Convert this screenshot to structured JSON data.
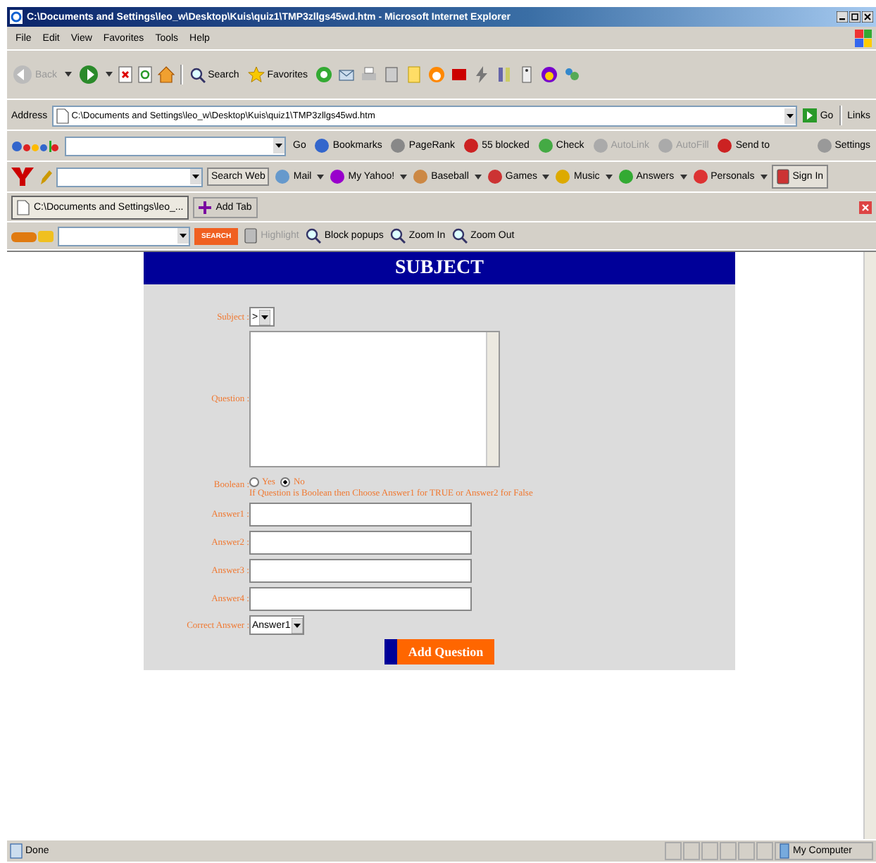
{
  "window": {
    "title": "C:\\Documents and Settings\\leo_w\\Desktop\\Kuis\\quiz1\\TMP3zllgs45wd.htm - Microsoft Internet Explorer"
  },
  "menu": [
    "File",
    "Edit",
    "View",
    "Favorites",
    "Tools",
    "Help"
  ],
  "toolbar": [
    {
      "label": "Back",
      "disabled": true
    },
    {
      "disabled": false
    },
    {
      "label": "Search",
      "disabled": false
    },
    {
      "label": "Favorites",
      "disabled": false
    }
  ],
  "address": {
    "label": "Address",
    "url": "C:\\Documents and Settings\\leo_w\\Desktop\\Kuis\\quiz1\\TMP3zllgs45wd.htm",
    "go": "Go",
    "links": "Links"
  },
  "google_bar": {
    "go": "Go",
    "items": [
      {
        "label": "Bookmarks",
        "disabled": false
      },
      {
        "label": "PageRank",
        "disabled": false
      },
      {
        "label": "55 blocked",
        "disabled": false
      },
      {
        "label": "Check",
        "disabled": false
      },
      {
        "label": "AutoLink",
        "disabled": true
      },
      {
        "label": "AutoFill",
        "disabled": true
      },
      {
        "label": "Send to",
        "disabled": false
      }
    ],
    "settings": "Settings"
  },
  "yahoo_bar": {
    "search": "Search Web",
    "items": [
      {
        "label": "Mail"
      },
      {
        "label": "My Yahoo!"
      },
      {
        "label": "Baseball"
      },
      {
        "label": "Games"
      },
      {
        "label": "Music"
      },
      {
        "label": "Answers"
      },
      {
        "label": "Personals"
      }
    ],
    "sign_in": "Sign In"
  },
  "tabs": [
    {
      "label": "C:\\Documents and Settings\\leo_...",
      "selected": true
    },
    {
      "label": "Add Tab",
      "selected": false
    }
  ],
  "crawler_bar": {
    "search": "SEARCH",
    "items": [
      {
        "label": "Highlight",
        "disabled": true
      },
      {
        "label": "Block popups",
        "disabled": false
      },
      {
        "label": "Zoom In",
        "disabled": false
      },
      {
        "label": "Zoom Out",
        "disabled": false
      }
    ]
  },
  "form": {
    "title": "SUBJECT",
    "subject": {
      "label": "Subject :",
      "value": ">"
    },
    "question": {
      "label": "Question :"
    },
    "boolean": {
      "label": "Boolean :",
      "options": [
        {
          "label": "Yes",
          "selected": false
        },
        {
          "label": "No",
          "selected": true
        }
      ],
      "hint": "If Question is Boolean then Choose Answer1 for TRUE or Answer2 for False"
    },
    "answers": [
      {
        "label": "Answer1 :"
      },
      {
        "label": "Answer2 :"
      },
      {
        "label": "Answer3 :"
      },
      {
        "label": "Answer4 :"
      }
    ],
    "correct": {
      "label": "Correct Answer :",
      "value": "Answer1"
    },
    "submit": "Add Question"
  },
  "status_bar": {
    "text": "Done",
    "zone": "My Computer"
  }
}
